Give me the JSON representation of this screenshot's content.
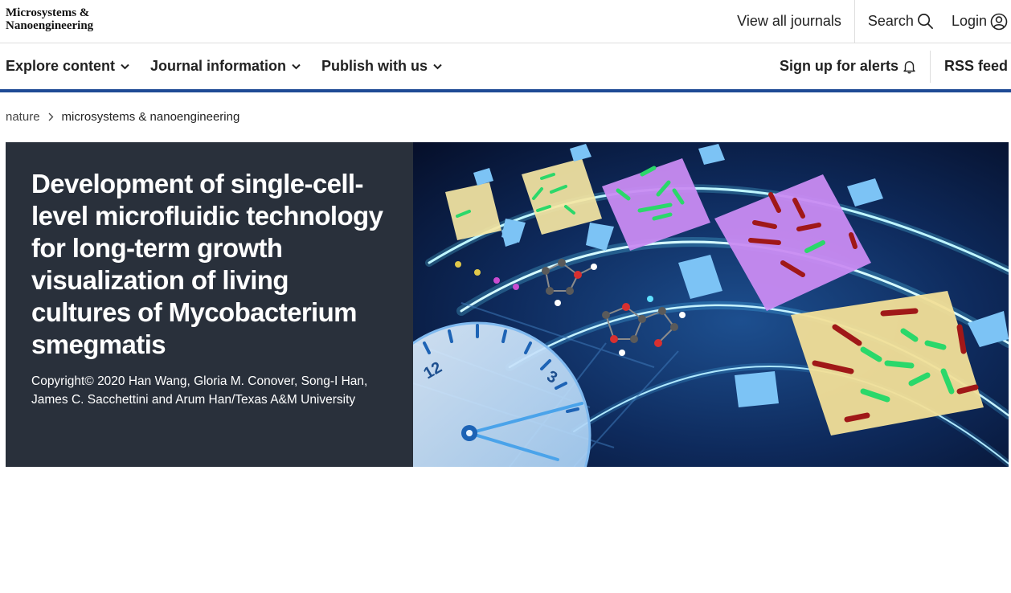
{
  "header": {
    "logo_text": "Microsystems &\nNanoengineering",
    "view_all_journals": "View all journals",
    "search": "Search",
    "login": "Login"
  },
  "nav": {
    "explore": "Explore content",
    "journal_info": "Journal information",
    "publish": "Publish with us",
    "alerts": "Sign up for alerts",
    "rss": "RSS feed"
  },
  "breadcrumb": {
    "root": "nature",
    "current": "microsystems & nanoengineering"
  },
  "hero": {
    "title": "Development of single-cell-level microfluidic technology for long-term growth visualization of living cultures of Mycobacterium smegmatis",
    "credit": "Copyright© 2020 Han Wang, Gloria M. Conover, Song-I Han, James C. Sacchettini and Arum Han/Texas A&M University",
    "clock_numbers": [
      "12",
      "3"
    ]
  },
  "colors": {
    "nav_underline": "#1e4a95",
    "hero_panel": "#29303b",
    "hero_text": "#ffffff"
  }
}
